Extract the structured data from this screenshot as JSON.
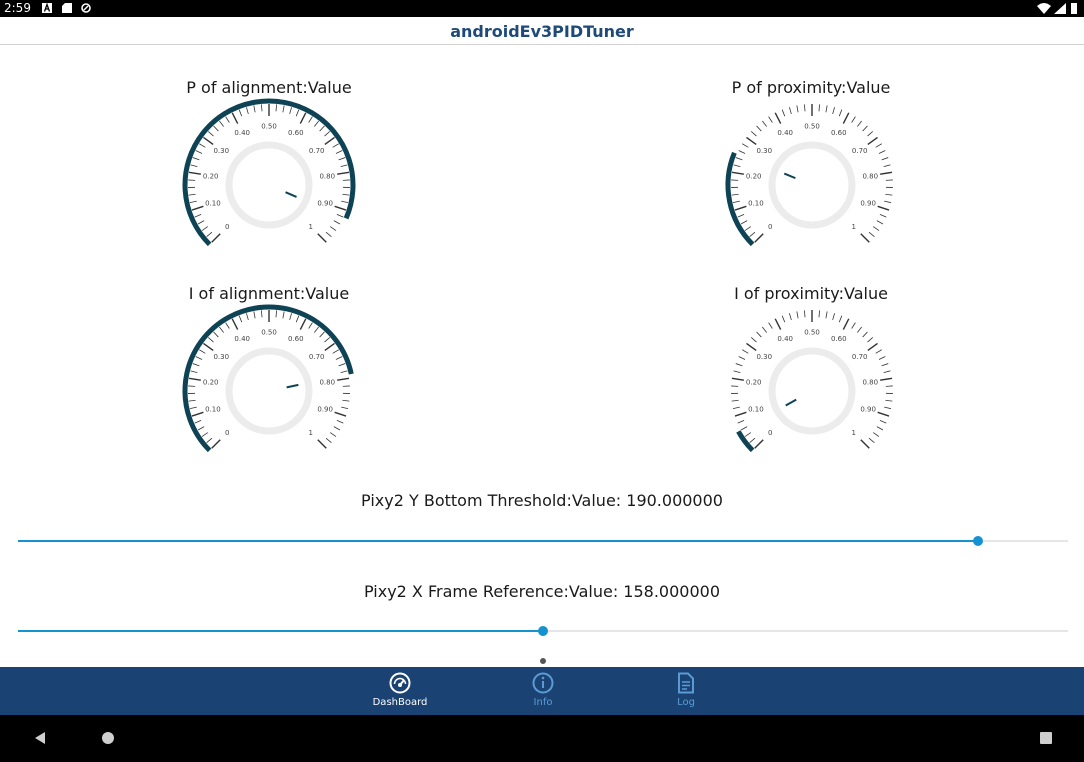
{
  "status_bar": {
    "time": "2:59"
  },
  "app_bar": {
    "title": "androidEv3PIDTuner"
  },
  "gauges": [
    {
      "title": "P of alignment:Value",
      "value": 0.92,
      "ticks": [
        "0",
        "0.10",
        "0.20",
        "0.30",
        "0.40",
        "0.50",
        "0.60",
        "0.70",
        "0.80",
        "0.90",
        "1"
      ]
    },
    {
      "title": "P of proximity:Value",
      "value": 0.25,
      "ticks": [
        "0",
        "0.10",
        "0.20",
        "0.30",
        "0.40",
        "0.50",
        "0.60",
        "0.70",
        "0.80",
        "0.90",
        "1"
      ]
    },
    {
      "title": "I of alignment:Value",
      "value": 0.79,
      "ticks": [
        "0",
        "0.10",
        "0.20",
        "0.30",
        "0.40",
        "0.50",
        "0.60",
        "0.70",
        "0.80",
        "0.90",
        "1"
      ]
    },
    {
      "title": "I of proximity:Value",
      "value": 0.06,
      "ticks": [
        "0",
        "0.10",
        "0.20",
        "0.30",
        "0.40",
        "0.50",
        "0.60",
        "0.70",
        "0.80",
        "0.90",
        "1"
      ]
    }
  ],
  "sliders": [
    {
      "label": "Pixy2 Y Bottom Threshold:Value: 190.000000",
      "fraction": 0.914
    },
    {
      "label": "Pixy2 X Frame Reference:Value: 158.000000",
      "fraction": 0.5
    }
  ],
  "bottom_nav": {
    "items": [
      {
        "label": "DashBoard",
        "icon": "gauge-icon",
        "active": true
      },
      {
        "label": "Info",
        "icon": "info-icon",
        "active": false
      },
      {
        "label": "Log",
        "icon": "document-icon",
        "active": false
      }
    ]
  },
  "colors": {
    "accent": "#1493d0",
    "gauge_arc": "#0e4255",
    "nav_bg": "#1a4374",
    "nav_active": "#ffffff",
    "nav_inactive": "#5b9bd5",
    "title": "#1e4a7a"
  }
}
